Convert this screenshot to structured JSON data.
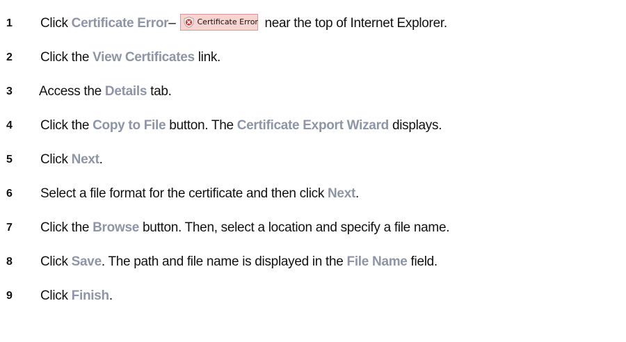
{
  "steps": [
    {
      "num": "1",
      "parts": {
        "a": "Click ",
        "b": "Certificate Error",
        "c": "–",
        "badge": "Certificate Error",
        "d": "near the top of Internet Explorer."
      }
    },
    {
      "num": "2",
      "parts": {
        "a": "Click the ",
        "b": "View Certificates",
        "c": " link."
      }
    },
    {
      "num": "3",
      "parts": {
        "a": "Access the ",
        "b": "Details",
        "c": " tab."
      }
    },
    {
      "num": "4",
      "parts": {
        "a": "Click the ",
        "b": "Copy to File",
        "c": " button. The ",
        "d": "Certificate Export Wizard",
        "e": " displays."
      }
    },
    {
      "num": "5",
      "parts": {
        "a": "Click ",
        "b": "Next",
        "c": "."
      }
    },
    {
      "num": "6",
      "parts": {
        "a": "Select a file format for the certificate and then click ",
        "b": "Next",
        "c": "."
      }
    },
    {
      "num": "7",
      "parts": {
        "a": "Click the ",
        "b": "Browse",
        "c": " button. Then, select a location and specify a file name."
      }
    },
    {
      "num": "8",
      "parts": {
        "a": "Click ",
        "b": "Save",
        "c": ". The path and file name is displayed in the ",
        "d": "File Name",
        "e": " field."
      }
    },
    {
      "num": "9",
      "parts": {
        "a": "Click ",
        "b": "Finish",
        "c": "."
      }
    }
  ],
  "colors": {
    "highlight": "#8e95a6",
    "text": "#111111",
    "badge_bg": "#f7d4d0",
    "badge_border": "#d49a93",
    "error_icon": "#d9342b"
  },
  "icons": {
    "badge_icon": "shield-error-icon"
  }
}
